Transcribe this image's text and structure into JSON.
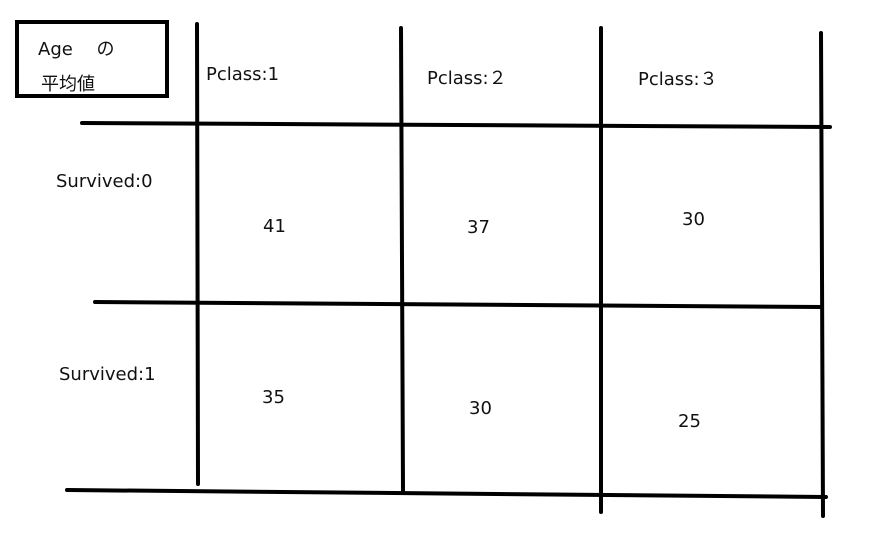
{
  "corner_label": {
    "line1": "Age　 の",
    "line2": "平均値"
  },
  "columns": [
    "Pclass:1",
    "Pclass:２",
    "Pclass:３"
  ],
  "rows": [
    "Survived:0",
    "Survived:1"
  ],
  "cells": [
    [
      "41",
      "37",
      "30"
    ],
    [
      "35",
      "30",
      "25"
    ]
  ],
  "colors": {
    "line": "#000000",
    "text": "#111111",
    "background": "#ffffff"
  }
}
